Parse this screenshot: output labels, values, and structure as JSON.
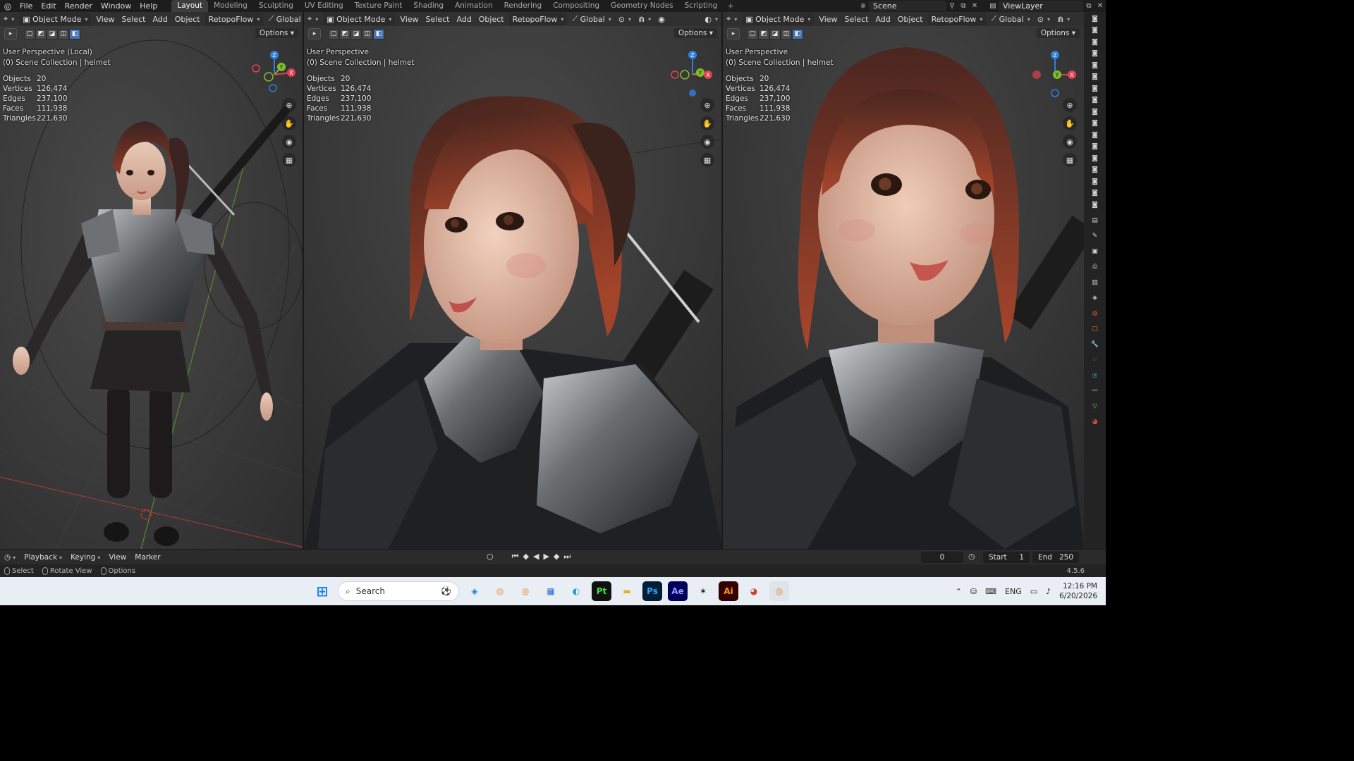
{
  "topbar": {
    "menus": [
      "File",
      "Edit",
      "Render",
      "Window",
      "Help"
    ],
    "workspaces": [
      "Layout",
      "Modeling",
      "Sculpting",
      "UV Editing",
      "Texture Paint",
      "Shading",
      "Animation",
      "Rendering",
      "Compositing",
      "Geometry Nodes",
      "Scripting"
    ],
    "active_workspace": "Layout",
    "scene": "Scene",
    "view_layer": "ViewLayer"
  },
  "viewport_header": {
    "mode": "Object Mode",
    "view": "View",
    "select": "Select",
    "add": "Add",
    "object": "Object",
    "addon": "RetopoFlow",
    "orientation": "Global",
    "options": "Options"
  },
  "viewports": [
    {
      "perspective": "User Perspective (Local)",
      "collection": "(0) Scene Collection | helmet",
      "stats": [
        {
          "k": "Objects",
          "v": "20"
        },
        {
          "k": "Vertices",
          "v": "126,474"
        },
        {
          "k": "Edges",
          "v": "237,100"
        },
        {
          "k": "Faces",
          "v": "111,938"
        },
        {
          "k": "Triangles",
          "v": "221,630"
        }
      ]
    },
    {
      "perspective": "User Perspective",
      "collection": "(0) Scene Collection | helmet",
      "stats": [
        {
          "k": "Objects",
          "v": "20"
        },
        {
          "k": "Vertices",
          "v": "126,474"
        },
        {
          "k": "Edges",
          "v": "237,100"
        },
        {
          "k": "Faces",
          "v": "111,938"
        },
        {
          "k": "Triangles",
          "v": "221,630"
        }
      ]
    },
    {
      "perspective": "User Perspective",
      "collection": "(0) Scene Collection | helmet",
      "stats": [
        {
          "k": "Objects",
          "v": "20"
        },
        {
          "k": "Vertices",
          "v": "126,474"
        },
        {
          "k": "Edges",
          "v": "237,100"
        },
        {
          "k": "Faces",
          "v": "111,938"
        },
        {
          "k": "Triangles",
          "v": "221,630"
        }
      ]
    }
  ],
  "gizmo_labels": {
    "z": "Z",
    "y": "Y",
    "x": "X"
  },
  "timeline": {
    "playback": "Playback",
    "keying": "Keying",
    "view": "View",
    "marker": "Marker",
    "current_frame": "0",
    "start_label": "Start",
    "start_value": "1",
    "end_label": "End",
    "end_value": "250"
  },
  "statusbar": {
    "select": "Select",
    "rotate": "Rotate View",
    "options": "Options",
    "version": "4.5.6"
  },
  "taskbar": {
    "search_placeholder": "Search",
    "language": "ENG",
    "time": "12:16 PM",
    "date": "6/20/2026"
  },
  "colors": {
    "accent": "#4772b3",
    "axis_x": "#e0404f",
    "axis_y": "#7fbf2a",
    "axis_z": "#2f7fdc"
  }
}
